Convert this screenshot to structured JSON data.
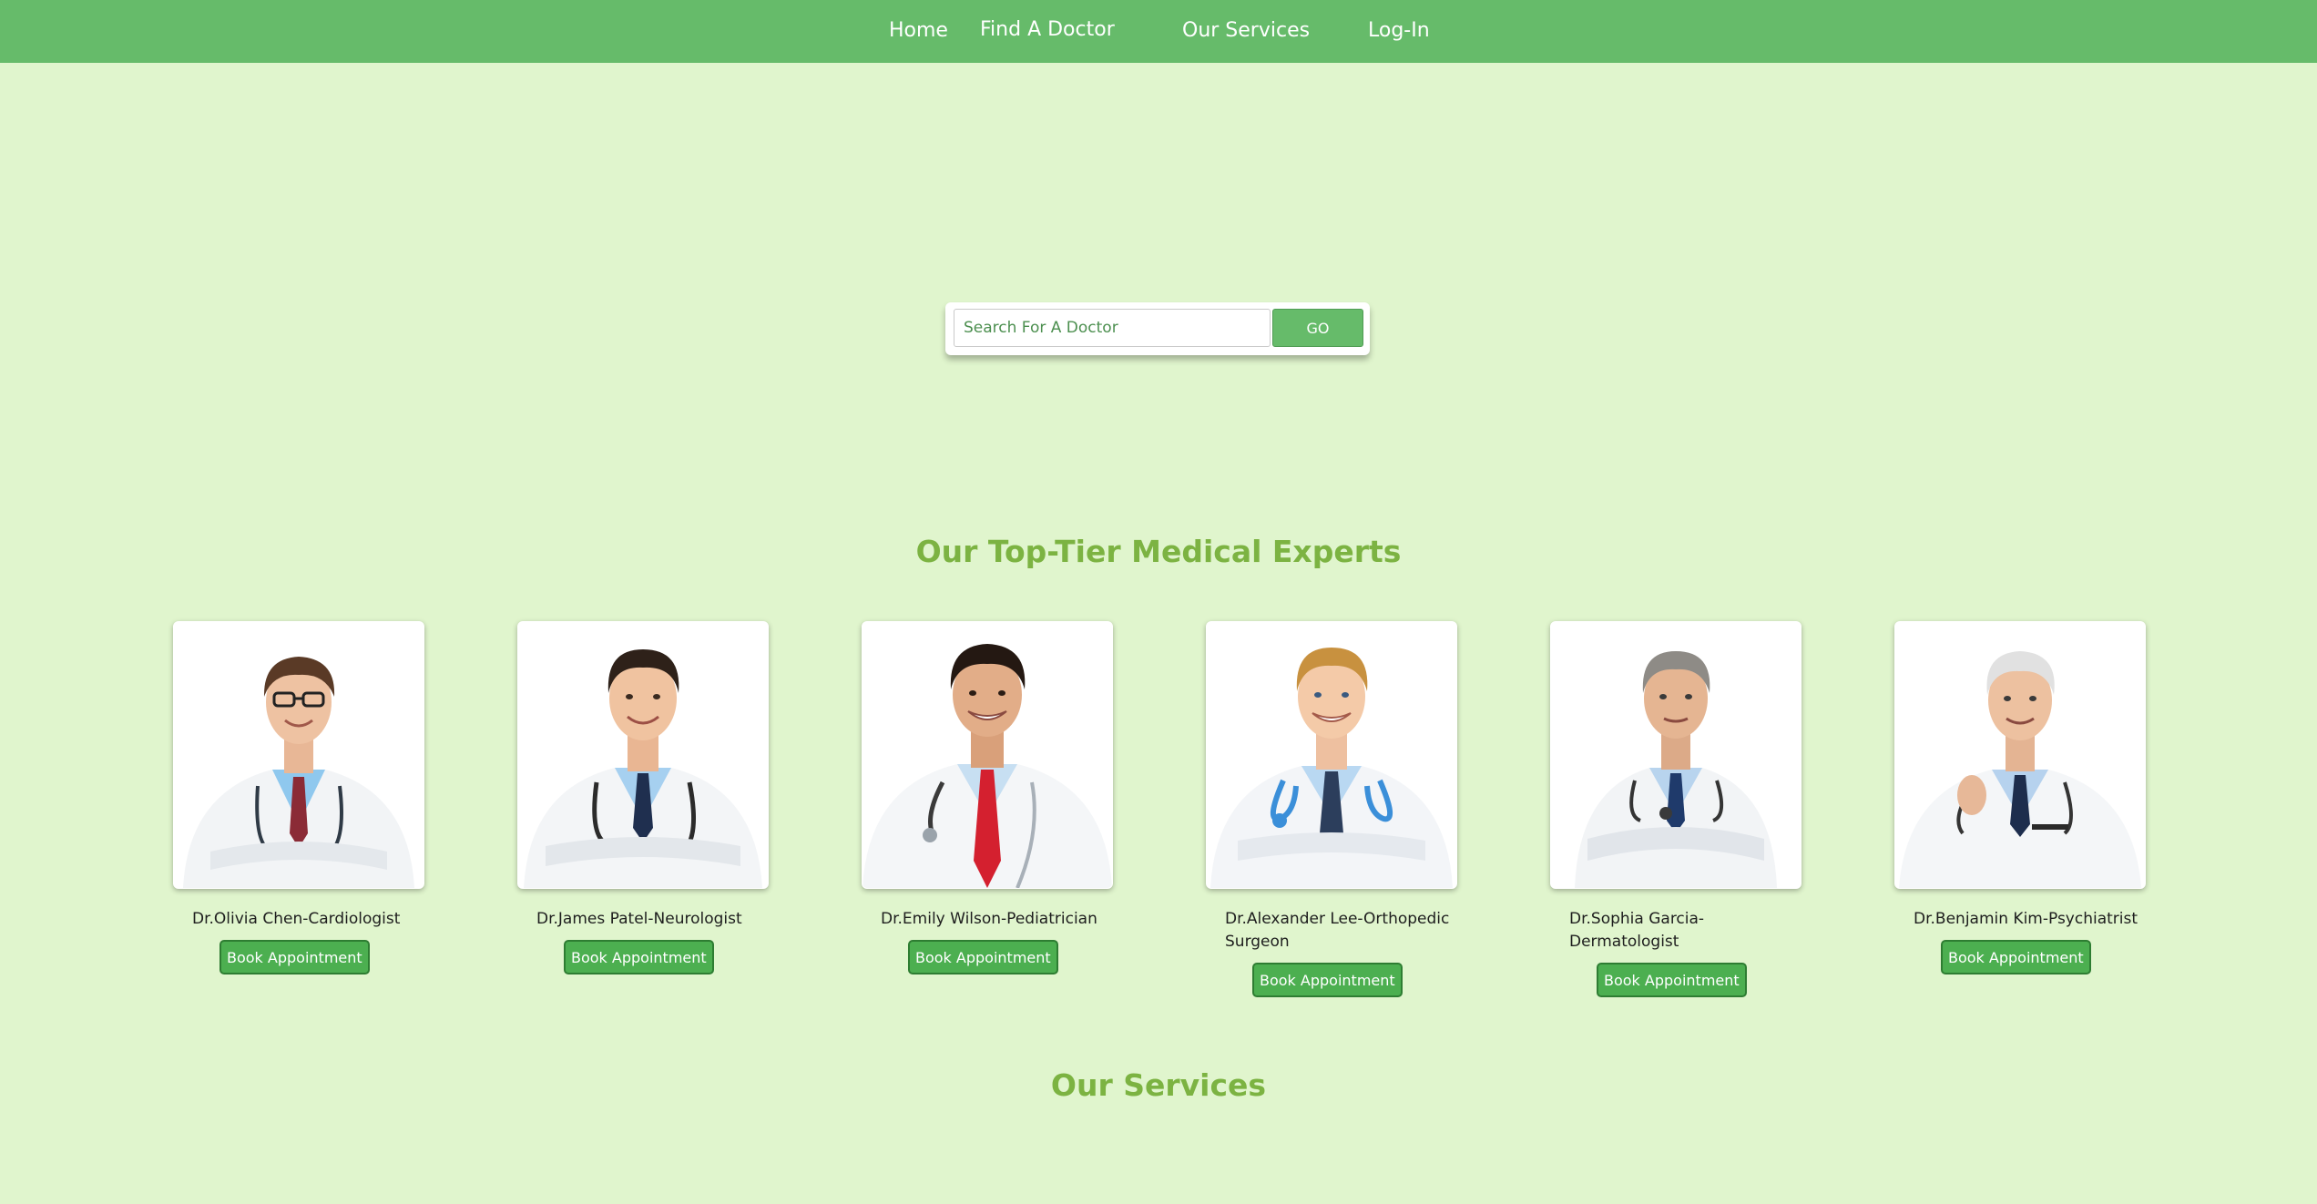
{
  "nav": {
    "home": "Home",
    "find_doctor": "Find A Doctor",
    "services": "Our Services",
    "login": "Log-In"
  },
  "search": {
    "placeholder": "Search For A Doctor",
    "button_label": "GO"
  },
  "experts": {
    "title": "Our Top-Tier Medical Experts",
    "doctors": [
      {
        "name": "Dr.Olivia Chen-Cardiologist",
        "button_label": "Book Appointment"
      },
      {
        "name": "Dr.James Patel-Neurologist",
        "button_label": "Book Appointment"
      },
      {
        "name": "Dr.Emily Wilson-Pediatrician",
        "button_label": "Book Appointment"
      },
      {
        "name": "Dr.Alexander Lee-Orthopedic Surgeon",
        "button_label": "Book Appointment"
      },
      {
        "name": "Dr.Sophia Garcia-Dermatologist",
        "button_label": "Book Appointment"
      },
      {
        "name": "Dr.Benjamin Kim-Psychiatrist",
        "button_label": "Book Appointment"
      }
    ]
  },
  "services": {
    "title": "Our Services"
  },
  "colors": {
    "navbar": "#66bb6a",
    "page_background": "#e0f5cd",
    "heading": "#7cb342",
    "button": "#4caf50"
  }
}
